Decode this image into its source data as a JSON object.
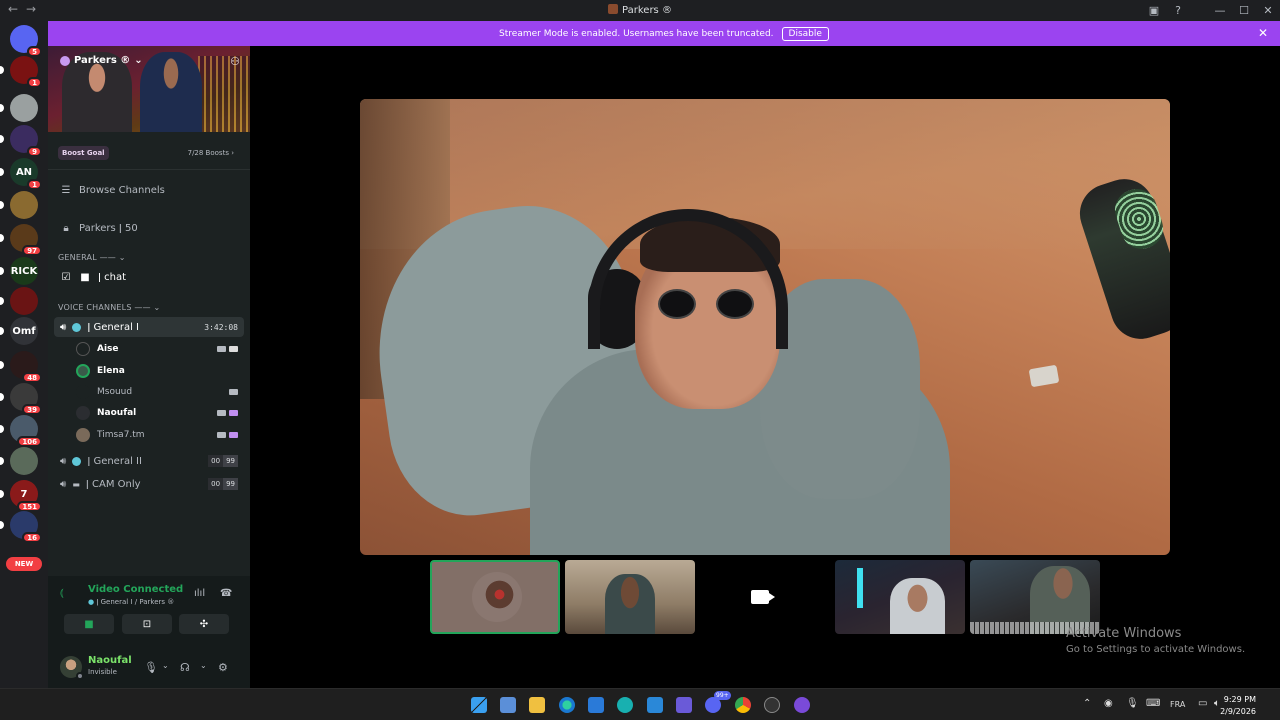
{
  "window": {
    "title": "Parkers ®",
    "controls": [
      "inbox-icon",
      "help-icon",
      "minimize-icon",
      "maximize-icon",
      "close-icon"
    ]
  },
  "rail": {
    "servers": [
      {
        "name": "discord-home",
        "badge": "5",
        "color": "#5865f2",
        "label": ""
      },
      {
        "name": "server-skull",
        "badge": "1",
        "color": "#7a1212",
        "label": ""
      },
      {
        "name": "server-2",
        "badge": "",
        "color": "#9aa0a0",
        "label": ""
      },
      {
        "name": "server-3",
        "badge": "9",
        "color": "#3b2c60",
        "label": ""
      },
      {
        "name": "server-4",
        "badge": "1",
        "color": "#1a3a2a",
        "label": "AN"
      },
      {
        "name": "server-5",
        "badge": "",
        "color": "#8a6a30",
        "label": ""
      },
      {
        "name": "server-6",
        "badge": "97",
        "color": "#5a3a1a",
        "label": ""
      },
      {
        "name": "server-rick",
        "badge": "",
        "color": "#1a3a1a",
        "label": "RICK"
      },
      {
        "name": "server-7",
        "badge": "",
        "color": "#6a1414",
        "label": ""
      },
      {
        "name": "server-omf",
        "badge": "",
        "color": "#313338",
        "label": "Omf"
      },
      {
        "name": "server-8",
        "badge": "48",
        "color": "#2a1a1a",
        "label": ""
      },
      {
        "name": "server-9",
        "badge": "39",
        "color": "#3a3a3a",
        "label": ""
      },
      {
        "name": "server-10",
        "badge": "106",
        "color": "#4a5a6a",
        "label": ""
      },
      {
        "name": "server-11",
        "badge": "",
        "color": "#5a6a5a",
        "label": ""
      },
      {
        "name": "server-12",
        "badge": "151",
        "color": "#8a1a1a",
        "label": "7"
      },
      {
        "name": "server-13",
        "badge": "16",
        "color": "#2a3a6a",
        "label": ""
      }
    ],
    "new_label": "NEW"
  },
  "banner": {
    "text": "Streamer Mode is enabled. Usernames have been truncated.",
    "button": "Disable"
  },
  "server": {
    "name": "Parkers ®",
    "boost_goal": "Boost Goal",
    "boost_count": "7/28 Boosts",
    "browse": "Browse Channels",
    "locked_channel": "Parkers ǀ 50",
    "category_general": "GENERAL ——",
    "chat": "ǀ chat",
    "category_voice": "VOICE CHANNELS ——",
    "voice_channels": [
      {
        "name": "ǀ General I",
        "time": "3:42:08"
      },
      {
        "name": "ǀ General II",
        "limit_a": "00",
        "limit_b": "99"
      },
      {
        "name": "ǀ CAM Only",
        "limit_a": "00",
        "limit_b": "99"
      }
    ],
    "users": [
      {
        "name": "Aise",
        "bold": true,
        "color": "#2b2d31"
      },
      {
        "name": "Elena",
        "bold": true,
        "color": "#3a5a4a"
      },
      {
        "name": "Msouud",
        "bold": false,
        "color": "#1c2222"
      },
      {
        "name": "Naoufal",
        "bold": true,
        "color": "#2b2d31"
      },
      {
        "name": "Timsa7.tm",
        "bold": false,
        "color": "#7a6a5a"
      }
    ]
  },
  "voice": {
    "status": "Video Connected",
    "channel": "ǀ General I / Parkers ®"
  },
  "me": {
    "name": "Naoufal",
    "status": "Invisible"
  },
  "watermark": {
    "title": "Activate Windows",
    "sub": "Go to Settings to activate Windows."
  },
  "taskbar": {
    "language": "FRA",
    "time": "9:29 PM",
    "date": "2/9/2026",
    "discord_badge": "99+"
  }
}
